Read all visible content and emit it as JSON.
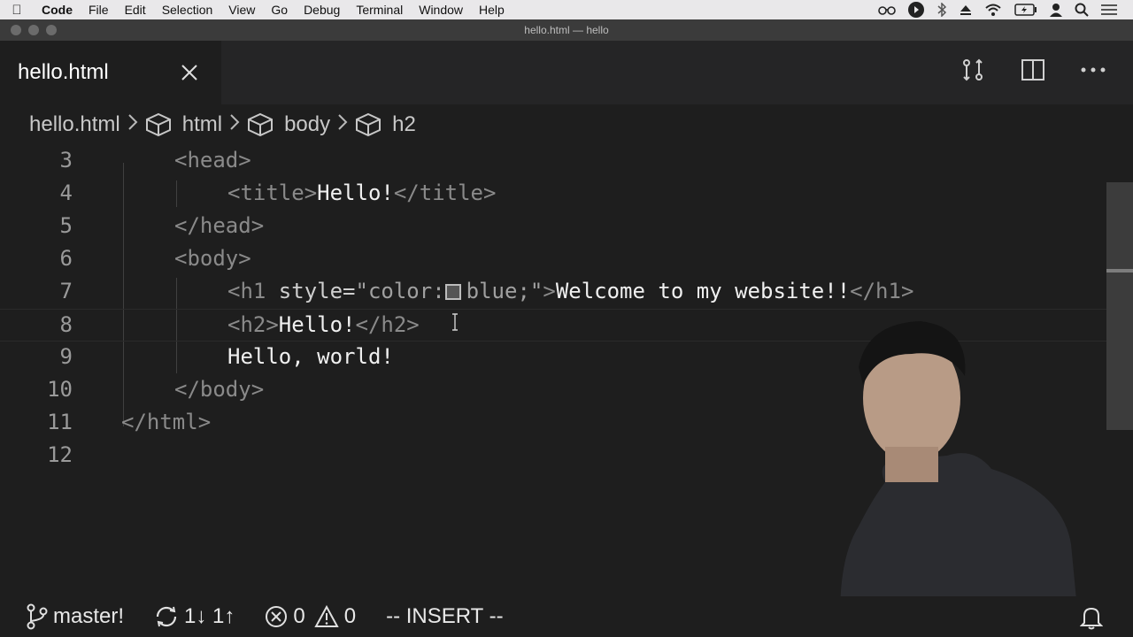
{
  "menubar": {
    "app": "Code",
    "items": [
      "File",
      "Edit",
      "Selection",
      "View",
      "Go",
      "Debug",
      "Terminal",
      "Window",
      "Help"
    ]
  },
  "window": {
    "title": "hello.html — hello"
  },
  "tab": {
    "label": "hello.html"
  },
  "breadcrumb": {
    "file": "hello.html",
    "items": [
      "html",
      "body",
      "h2"
    ]
  },
  "editor": {
    "line_numbers": [
      "3",
      "4",
      "5",
      "6",
      "7",
      "8",
      "9",
      "10",
      "11",
      "12"
    ],
    "lines": {
      "l3": "<head>",
      "l4_open": "<title>",
      "l4_text": "Hello!",
      "l4_close": "</title>",
      "l5": "</head>",
      "l6": "<body>",
      "l7_open": "<h1 ",
      "l7_attr": "style=",
      "l7_str1": "\"color:",
      "l7_str2": "blue;\"",
      "l7_gt": ">",
      "l7_text": "Welcome to my website!!",
      "l7_close": "</h1>",
      "l8_open": "<h2>",
      "l8_text": "Hello!",
      "l8_close": "</h2>",
      "l9_text": "Hello, world!",
      "l10": "</body>",
      "l11": "</html>"
    }
  },
  "statusbar": {
    "branch": "master!",
    "sync": "1↓ 1↑",
    "errors": "0",
    "warnings": "0",
    "mode": "-- INSERT --"
  },
  "colors": {
    "background": "#1e1e1e",
    "menubar": "#e9e8ea",
    "tab_active": "#1e1e1e"
  }
}
